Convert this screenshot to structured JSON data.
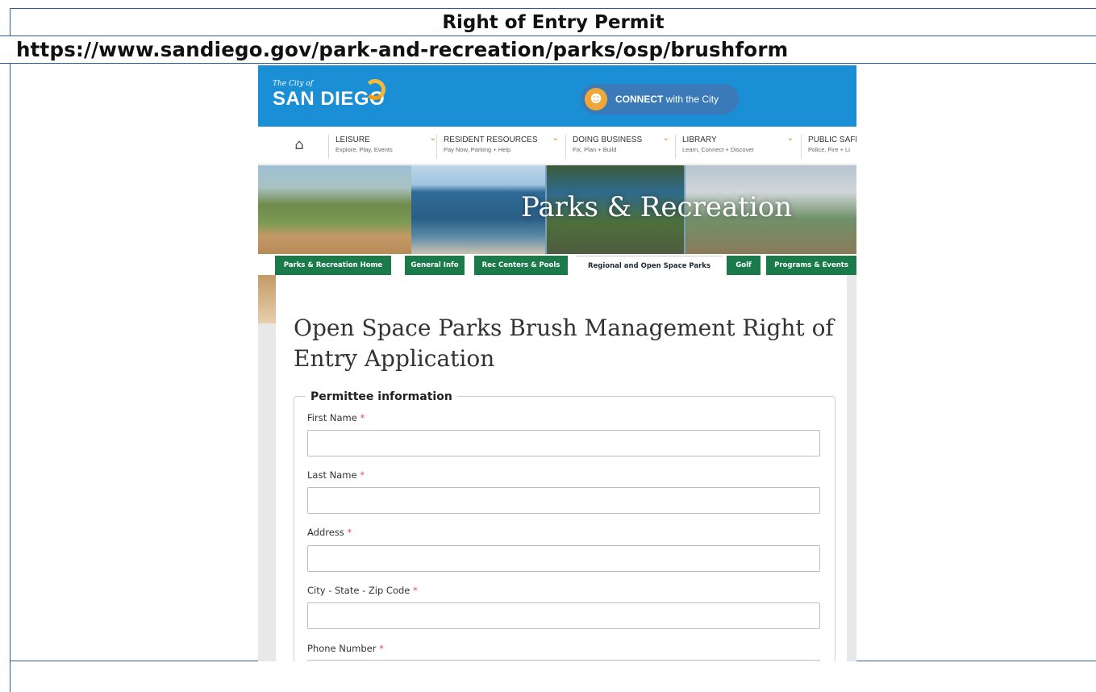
{
  "document": {
    "title": "Right of Entry Permit",
    "url": "https://www.sandiego.gov/park-and-recreation/parks/osp/brushform"
  },
  "header": {
    "logo_small": "The City of",
    "logo_big": "SAN DIEGO",
    "connect_bold": "CONNECT",
    "connect_rest": " with the City",
    "brand_color": "#1b8fd6"
  },
  "nav": {
    "items": [
      {
        "label": "LEISURE",
        "sub": "Explore, Play, Events"
      },
      {
        "label": "RESIDENT RESOURCES",
        "sub": "Pay Now, Parking + Help"
      },
      {
        "label": "DOING BUSINESS",
        "sub": "Fix, Plan + Build"
      },
      {
        "label": "LIBRARY",
        "sub": "Learn, Connect + Discover"
      },
      {
        "label": "PUBLIC SAFE",
        "sub": "Police, Fire + Li"
      }
    ]
  },
  "banner": {
    "title": "Parks & Recreation"
  },
  "tabs": [
    {
      "label": "Parks & Recreation Home"
    },
    {
      "label": "General Info"
    },
    {
      "label": "Rec Centers & Pools"
    },
    {
      "label": "Regional and Open Space Parks",
      "active": true
    },
    {
      "label": "Golf"
    },
    {
      "label": "Programs & Events"
    }
  ],
  "page": {
    "heading": "Open Space Parks Brush Management Right of Entry Application"
  },
  "form": {
    "legend": "Permittee information",
    "required_mark": "*",
    "fields": [
      {
        "label": "First Name",
        "value": ""
      },
      {
        "label": "Last Name",
        "value": ""
      },
      {
        "label": "Address",
        "value": ""
      },
      {
        "label": "City - State - Zip Code",
        "value": ""
      },
      {
        "label": "Phone Number",
        "value": ""
      }
    ]
  }
}
